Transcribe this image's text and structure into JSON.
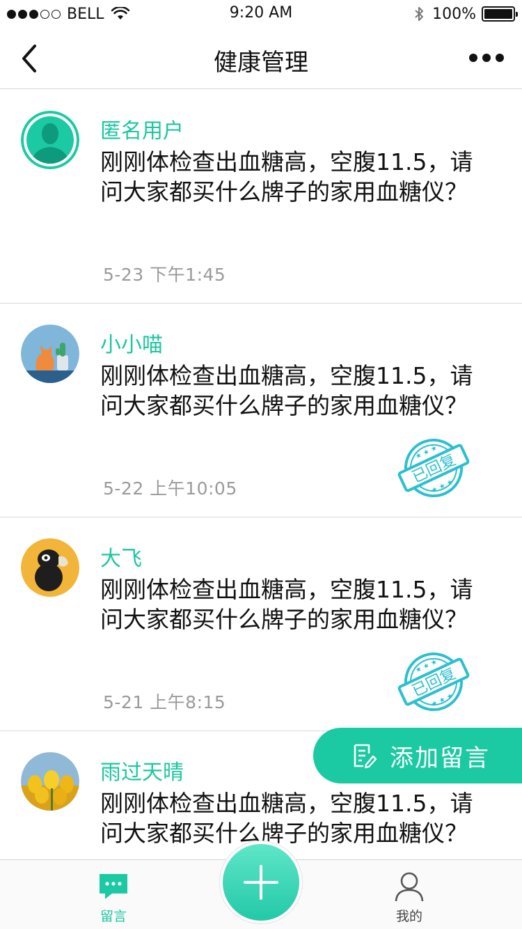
{
  "status_bar": {
    "carrier": "BELL",
    "time": "9:20 AM",
    "battery": "100%",
    "signal_full_dots": 3,
    "signal_total_dots": 5
  },
  "nav": {
    "title": "健康管理",
    "back_icon": "chevron-left-icon",
    "more_icon": "more-icon"
  },
  "messages": [
    {
      "user": "匿名用户",
      "content": "刚刚体检查出血糖高，空腹11.5，请问大家都买什么牌子的家用血糖仪？",
      "time": "5-23  下午1:45",
      "replied": false
    },
    {
      "user": "小小喵",
      "content": "刚刚体检查出血糖高，空腹11.5，请问大家都买什么牌子的家用血糖仪？",
      "time": "5-22  上午10:05",
      "replied": true,
      "stamp_text": "已回复"
    },
    {
      "user": "大飞",
      "content": "刚刚体检查出血糖高，空腹11.5，请问大家都买什么牌子的家用血糖仪？",
      "time": "5-21  上午8:15",
      "replied": true,
      "stamp_text": "已回复"
    },
    {
      "user": "雨过天晴",
      "content": "刚刚体检查出血糖高，空腹11.5，请问大家都买什么牌子的家用血糖仪？",
      "time": "",
      "replied": false
    }
  ],
  "fab": {
    "label": "添加留言",
    "icon": "edit-note-icon"
  },
  "tab_bar": {
    "tabs": [
      {
        "label": "留言",
        "icon": "chat-bubble-icon",
        "active": true
      },
      {
        "label": "我的",
        "icon": "person-icon",
        "active": false
      }
    ],
    "center_icon": "plus-icon"
  },
  "colors": {
    "accent": "#1bc9a2",
    "time_text": "#9a9a9a",
    "divider": "#d9d9d9"
  }
}
